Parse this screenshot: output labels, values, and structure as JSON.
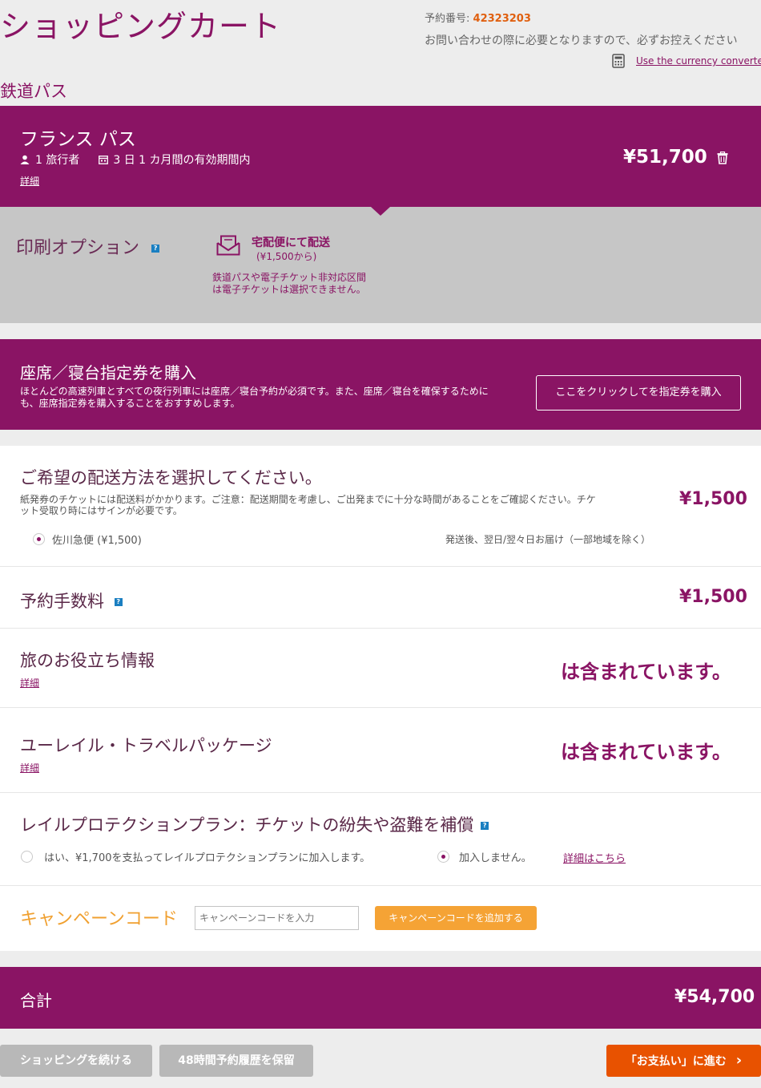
{
  "header": {
    "title": "ショッピングカート",
    "booking_label": "予約番号:",
    "booking_number": "42323203",
    "booking_note": "お問い合わせの際に必要となりますので、必ずお控えください",
    "currency_converter": "Use the currency converter"
  },
  "section_label": "鉄道パス",
  "pass": {
    "name": "フランス パス",
    "travelers": "1 旅行者",
    "validity": "3 日 1 カ月間の有効期間内",
    "details": "詳細",
    "price": "¥51,700"
  },
  "print_options": {
    "title": "印刷オプション",
    "help": "?",
    "delivery_title": "宅配便にて配送",
    "delivery_price": "(¥1,500から)",
    "note": "鉄道パスや電子チケット非対応区間は電子チケットは選択できません。"
  },
  "seat_reservation": {
    "title": "座席／寝台指定券を購入",
    "description": "ほとんどの高速列車とすべての夜行列車には座席／寝台予約が必須です。また、座席／寝台を確保するためにも、座席指定券を購入することをおすすめします。",
    "button": "ここをクリックしてを指定券を購入"
  },
  "shipping": {
    "title": "ご希望の配送方法を選択してください。",
    "description": "紙発券のチケットには配送料がかかります。ご注意：配送期間を考慮し、ご出発までに十分な時間があることをご確認ください。チケット受取り時にはサインが必要です。",
    "price": "¥1,500",
    "option_label": "佐川急便 (¥1,500)",
    "option_note": "発送後、翌日/翌々日お届け（一部地域を除く）"
  },
  "booking_fee": {
    "title": "予約手数料",
    "help": "?",
    "price": "¥1,500"
  },
  "travel_info": {
    "title": "旅のお役立ち情報",
    "details": "詳細",
    "status": "は含まれています。"
  },
  "travel_package": {
    "title": "ユーレイル・トラベルパッケージ",
    "details": "詳細",
    "status": "は含まれています。"
  },
  "protection": {
    "title": "レイルプロテクションプラン：チケットの紛失や盗難を補償",
    "help": "?",
    "option_yes": "はい、¥1,700を支払ってレイルプロテクションプランに加入します。",
    "option_no": "加入しません。",
    "more": "詳細はこちら"
  },
  "campaign": {
    "title": "キャンペーンコード",
    "placeholder": "キャンペーンコードを入力",
    "button": "キャンペーンコードを追加する"
  },
  "total": {
    "label": "合計",
    "amount": "¥54,700"
  },
  "footer": {
    "continue": "ショッピングを続ける",
    "save": "48時間予約履歴を保留",
    "checkout": "「お支払い」に進む",
    "checkout_arrow": "›"
  },
  "colors": {
    "brand_purple": "#8a1464",
    "accent_orange": "#f0a030",
    "booking_number": "#e06010",
    "checkout": "#e85200"
  },
  "icons": [
    "user-icon",
    "calendar-icon",
    "trash-icon",
    "envelope-icon",
    "calculator-icon",
    "help-icon",
    "chevron-right-icon"
  ]
}
